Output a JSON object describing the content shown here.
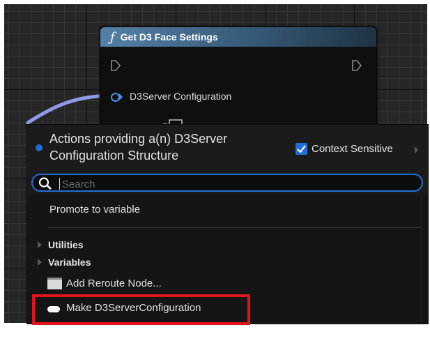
{
  "node": {
    "title": "Get D3 Face Settings",
    "function_symbol": "ƒ",
    "icons": [
      "function-icon",
      "exec-in-pin-icon",
      "exec-out-pin-icon",
      "struct-pin-icon"
    ],
    "output_pin_label": "D3Server Configuration",
    "colors": {
      "header": "#4a7498",
      "pin": "#4f8ef0",
      "wire": "#8e9ce8"
    }
  },
  "menu": {
    "title": "Actions providing a(n) D3Server Configuration Structure",
    "context_sensitive": {
      "label": "Context Sensitive",
      "checked": true
    },
    "search": {
      "placeholder": "Search",
      "value": ""
    },
    "promote_label": "Promote to variable",
    "categories": [
      {
        "label": "Utilities",
        "expanded": false
      },
      {
        "label": "Variables",
        "expanded": false
      }
    ],
    "add_reroute_label": "Add Reroute Node...",
    "make_label": "Make D3ServerConfiguration",
    "icons": [
      "pin-type-dot-icon",
      "checkbox-check-icon",
      "search-icon",
      "reroute-node-icon",
      "struct-make-icon",
      "expand-arrow-icon"
    ],
    "colors": {
      "accent": "#1f6fd6",
      "highlight_box": "#e0141a"
    }
  }
}
